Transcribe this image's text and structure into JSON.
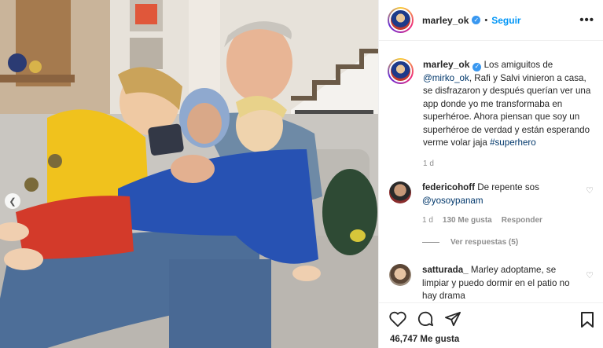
{
  "photo": {
    "alt": "",
    "prev_icon": "chevron-left-icon"
  },
  "post": {
    "author": "marley_ok",
    "follow_label": "Seguir",
    "separator": "•",
    "more_icon": "more-horizontal-icon",
    "more_label": "•••"
  },
  "caption": {
    "username": "marley_ok",
    "mention": "@mirko_ok",
    "text_after_mention": ", Rafi y Salvi vinieron a casa, se disfrazaron y después querían ver una app donde yo me transformaba en superhéroe. Ahora piensan que soy un superhéroe de verdad y están esperando verme volar jaja ",
    "hashtag": "#superhero",
    "time": "1 d"
  },
  "comments": [
    {
      "username": "federicohoff",
      "text": "De repente sos",
      "mention": "@yosoypanam",
      "time": "1 d",
      "likes": "130 Me gusta",
      "reply_label": "Responder",
      "view_replies": "Ver respuestas (5)"
    },
    {
      "username": "satturada_",
      "text": "Marley adoptame, se limpiar y puedo dormir en el patio no hay drama"
    }
  ],
  "actions": {
    "like_icon": "heart-icon",
    "comment_icon": "comment-icon",
    "share_icon": "share-icon",
    "save_icon": "bookmark-icon",
    "likes_count": "46,747 Me gusta"
  },
  "colors": {
    "link": "#00376b",
    "follow": "#0095f6",
    "verified": "#3897f0",
    "muted": "#8e8e8e"
  }
}
